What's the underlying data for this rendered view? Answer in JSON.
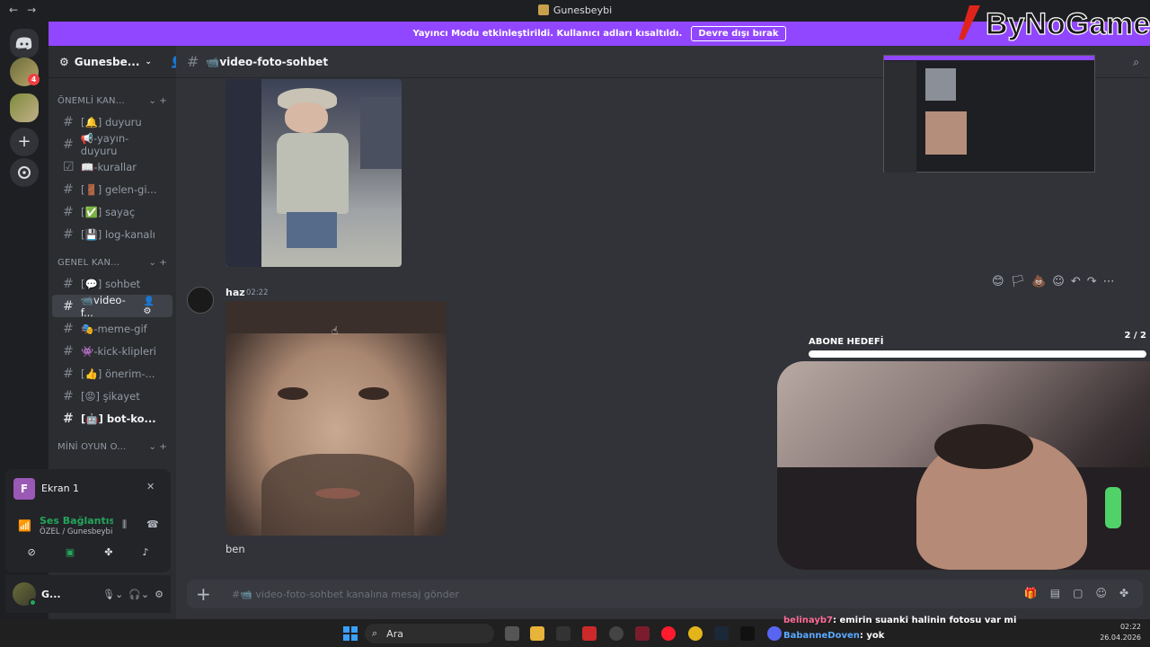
{
  "window": {
    "title": "Gunesbeybi",
    "back": "←",
    "forward": "→"
  },
  "banner": {
    "text": "Yayıncı Modu etkinleştirildi. Kullanıcı adları kısaltıldı.",
    "button": "Devre dışı bırak"
  },
  "guilds": {
    "badge": "4"
  },
  "server": {
    "name": "Gunesbe..."
  },
  "categories": [
    {
      "label": "ÖNEMLİ KAN..."
    },
    {
      "label": "GENEL KAN..."
    },
    {
      "label": "MİNİ OYUN O..."
    }
  ],
  "channels_important": [
    {
      "label": "[🔔] duyuru"
    },
    {
      "label": "📢-yayın-duyuru"
    },
    {
      "label": "📖-kurallar"
    },
    {
      "label": "[🚪] gelen-gi..."
    },
    {
      "label": "[✅] sayaç"
    },
    {
      "label": "[💾] log-kanalı"
    }
  ],
  "channels_general": [
    {
      "label": "[💬] sohbet"
    },
    {
      "label": "📹video-f..."
    },
    {
      "label": "🎭-meme-gif"
    },
    {
      "label": "👾-kick-klipleri"
    },
    {
      "label": "[👍] önerim-..."
    },
    {
      "label": "[😡] şikayet"
    },
    {
      "label": "[🤖] bot-ko..."
    }
  ],
  "voice_panel": {
    "screen_label": "Ekran 1",
    "screen_avatar": "F",
    "connection": "Ses Bağlantısı K",
    "location": "ÖZEL / Gunesbeybi"
  },
  "user": {
    "name": "G..."
  },
  "channel_header": {
    "name": "📹video-foto-sohbet"
  },
  "message": {
    "author": "haz",
    "time": "02:22",
    "text": "ben"
  },
  "composer": {
    "placeholder": "#📹 video-foto-sohbet kanalına mesaj gönder"
  },
  "overlay": {
    "goal_label": "ABONE HEDEFİ",
    "goal_count": "2 / 2",
    "goal_progress": 1.0,
    "logo_text": "ByNoGame"
  },
  "taskbar": {
    "search": "Ara",
    "time": "02:22",
    "date": "26.04.2026"
  },
  "stream_chat": [
    {
      "user": "belinayb7",
      "text": ": emirin suanki halinin fotosu var mi",
      "color": "#ff6b9a"
    },
    {
      "user": "BabanneDoven",
      "text": ": yok",
      "color": "#5aa9ff"
    }
  ],
  "colors": {
    "accent": "#9146ff",
    "online": "#23a55a",
    "blurple": "#5865f2"
  }
}
